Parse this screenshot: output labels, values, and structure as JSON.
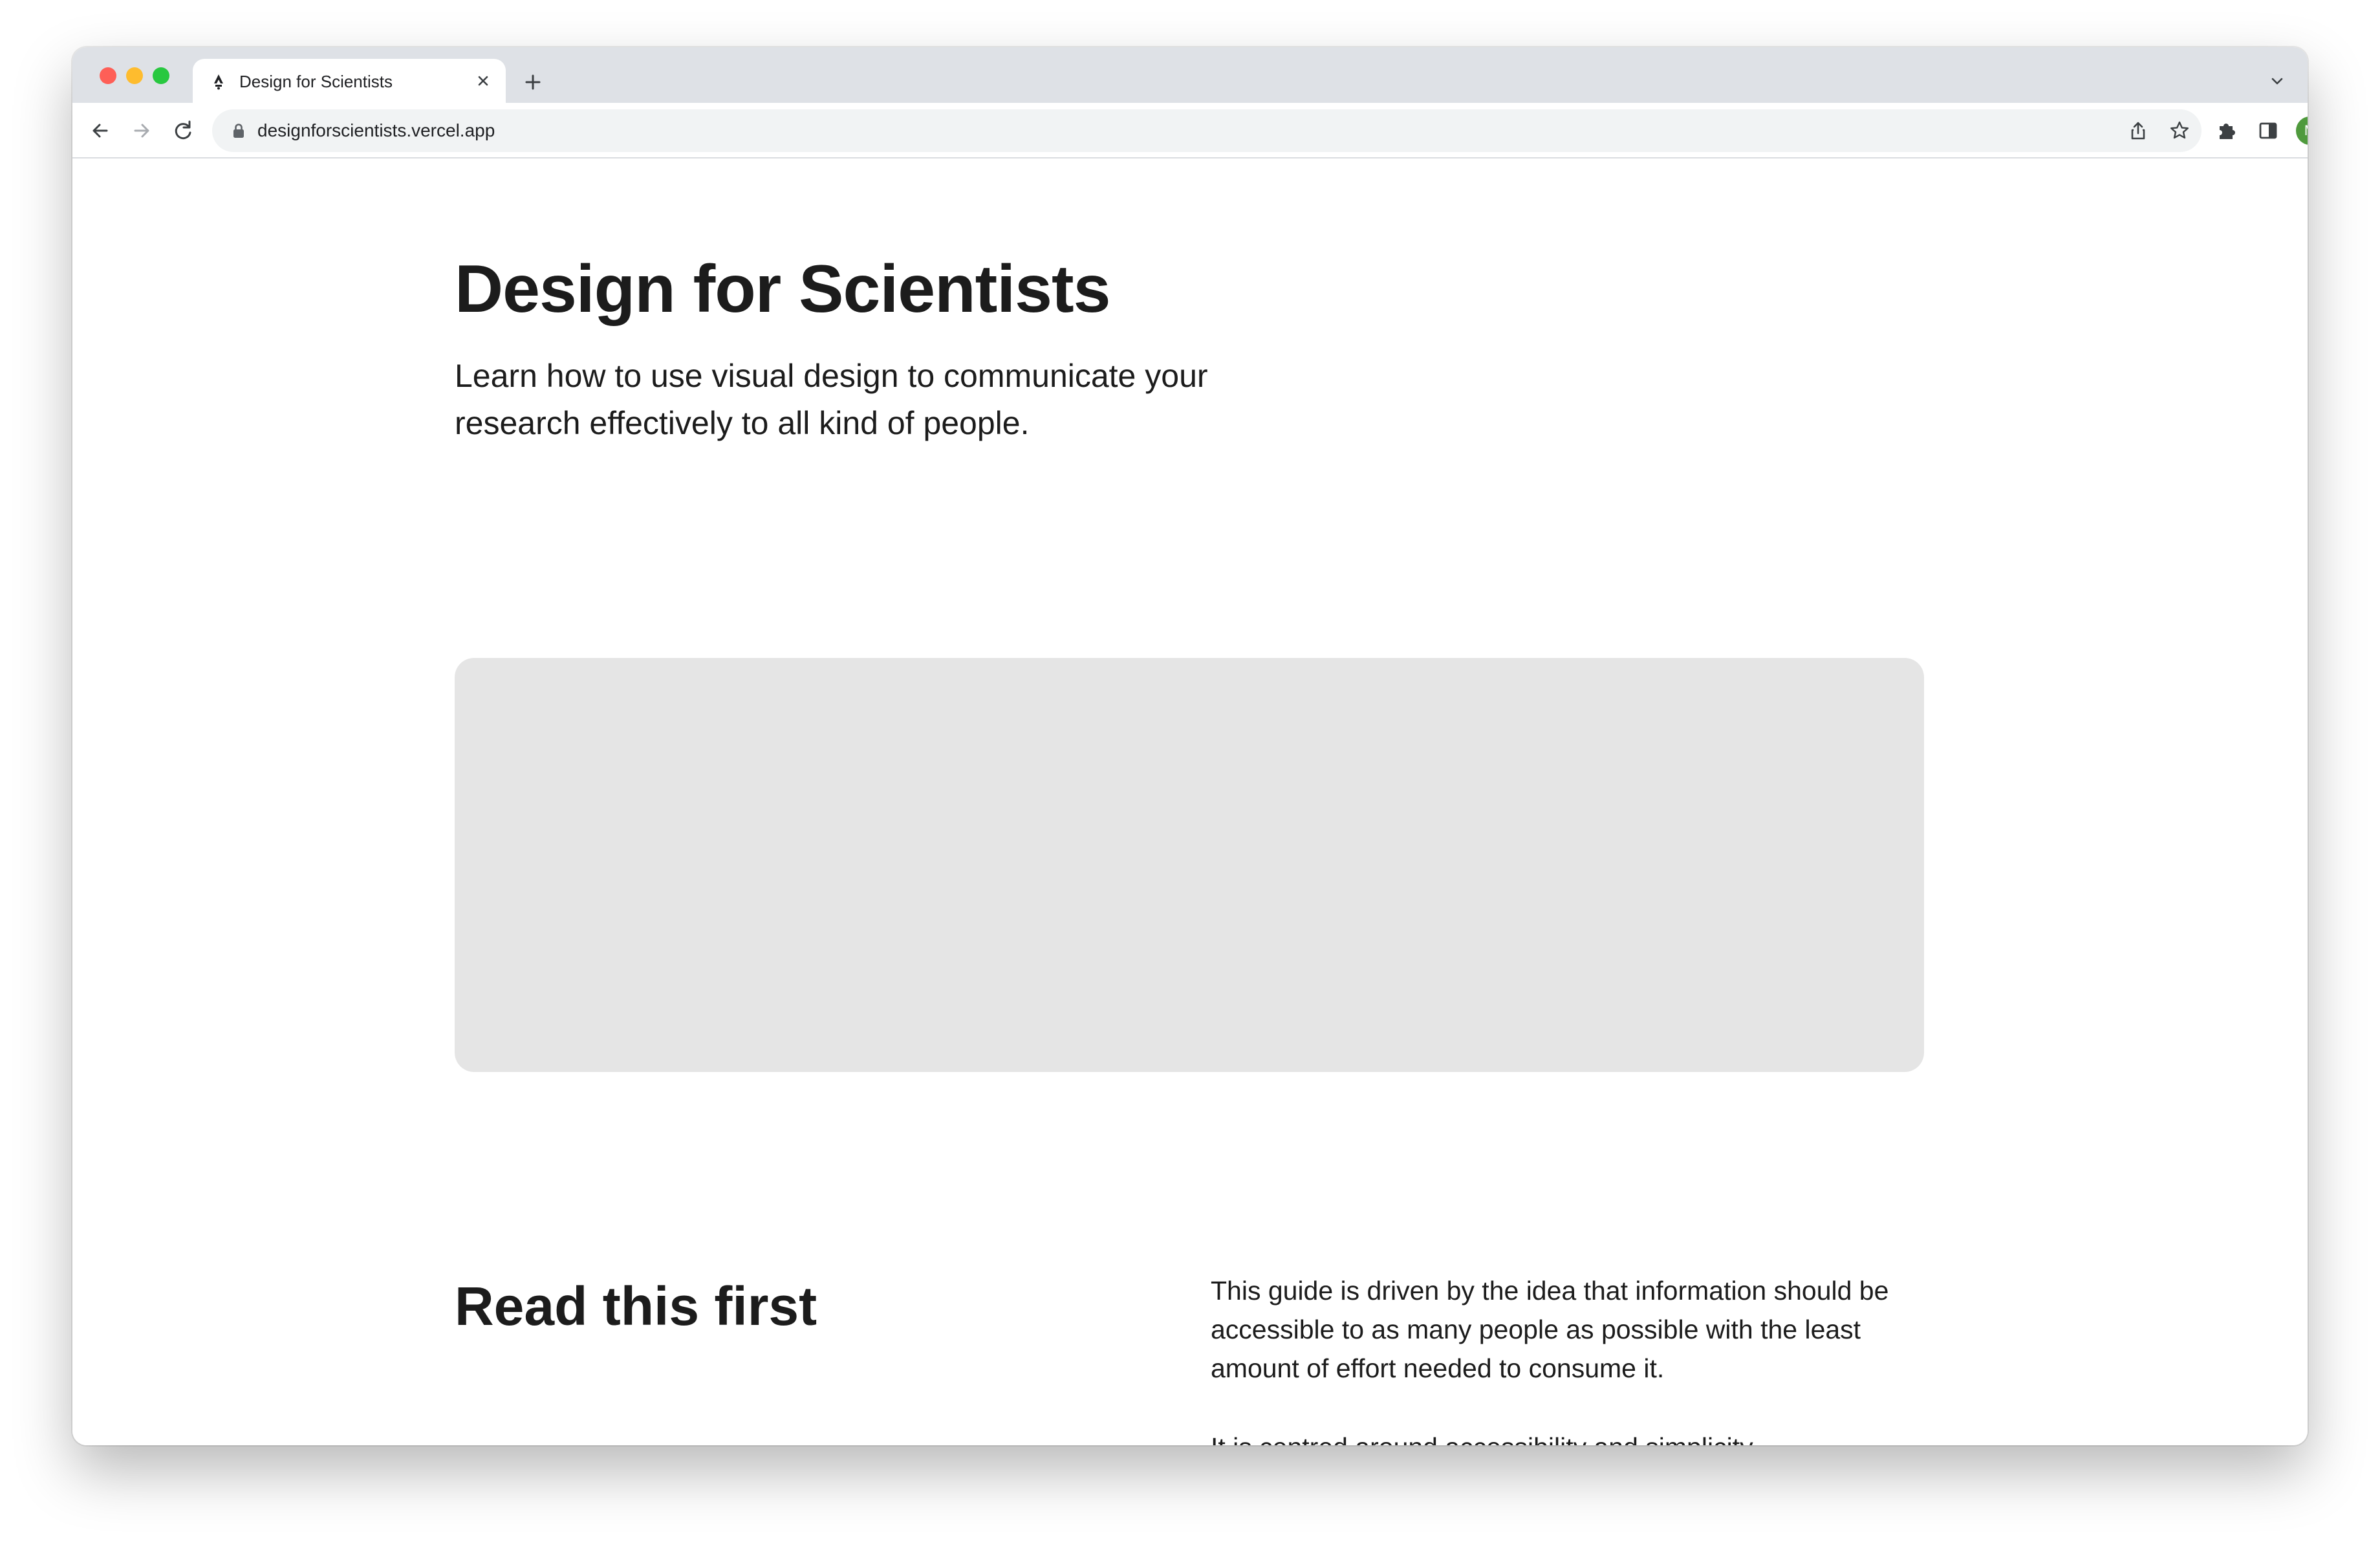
{
  "browser": {
    "tab": {
      "title": "Design for Scientists"
    },
    "address_bar": {
      "url": "designforscientists.vercel.app"
    },
    "profile": {
      "initial": "M",
      "color": "#4f9a3d"
    },
    "icons": {
      "back": "arrow-left-icon",
      "forward": "arrow-right-icon",
      "reload": "reload-icon",
      "lock": "lock-icon",
      "share": "share-icon",
      "bookmark": "star-icon",
      "extensions": "puzzle-icon",
      "side_panel": "side-panel-icon",
      "menu": "kebab-menu-icon",
      "new_tab": "plus-icon",
      "tab_close": "close-icon",
      "tab_search": "chevron-down-icon"
    }
  },
  "page": {
    "hero": {
      "title": "Design for Scientists",
      "subtitle": "Learn how to use visual design to communicate your research effectively to all kind of people."
    },
    "section": {
      "title": "Read this first",
      "paragraphs": [
        "This guide is driven by the idea that information should be accessible to as many people as possible with the least amount of effort needed to consume it.",
        "It is centred around accessibility and simplicity."
      ]
    }
  }
}
